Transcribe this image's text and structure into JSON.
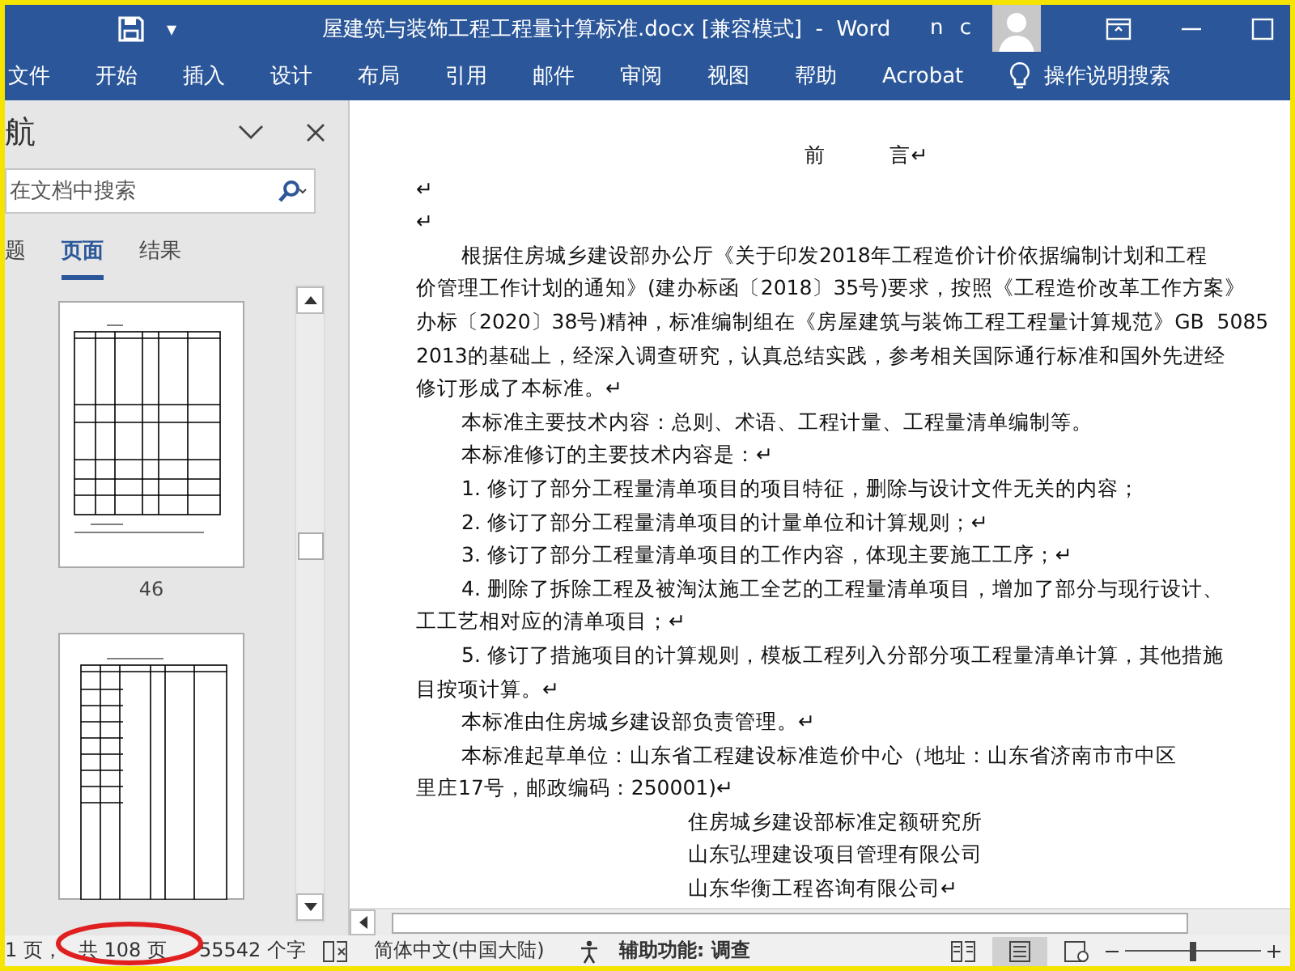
{
  "title_bar": {
    "quick_access_caret": "▾",
    "title": "屋建筑与装饰工程工程量计算标准.docx [兼容模式]  -  Word",
    "user": "n c"
  },
  "ribbon_tabs": [
    "文件",
    "开始",
    "插入",
    "设计",
    "布局",
    "引用",
    "邮件",
    "审阅",
    "视图",
    "帮助",
    "Acrobat"
  ],
  "tell_me": "操作说明搜索",
  "navigation": {
    "title": "航",
    "search": {
      "placeholder": "在文档中搜索"
    },
    "tabs": [
      {
        "label": "题",
        "selected": false
      },
      {
        "label": "页面",
        "selected": true
      },
      {
        "label": "结果",
        "selected": false
      }
    ],
    "pages": [
      {
        "number": "46",
        "kind": "wide"
      },
      {
        "kind": "narrow"
      }
    ]
  },
  "document": {
    "lines": [
      {
        "text": "前          言↵",
        "kind": "heading"
      },
      {
        "text": "↵",
        "kind": "plain"
      },
      {
        "text": "↵",
        "kind": "plain"
      },
      {
        "text": "根据住房城乡建设部办公厅《关于印发2018年工程造价计价依据编制计划和工程",
        "kind": "indent"
      },
      {
        "text": "价管理工作计划的通知》(建办标函〔2018〕35号)要求，按照《工程造价改革工作方案》",
        "kind": "plain"
      },
      {
        "text": "办标〔2020〕38号)精神，标准编制组在《房屋建筑与装饰工程工程量计算规范》GB  5085",
        "kind": "plain"
      },
      {
        "text": "2013的基础上，经深入调查研究，认真总结实践，参考相关国际通行标准和国外先进经",
        "kind": "plain"
      },
      {
        "text": "修订形成了本标准。↵",
        "kind": "plain"
      },
      {
        "text": "本标准主要技术内容：总则、术语、工程计量、工程量清单编制等。",
        "kind": "indent"
      },
      {
        "text": "本标准修订的主要技术内容是：↵",
        "kind": "indent"
      },
      {
        "text": "1. 修订了部分工程量清单项目的项目特征，删除与设计文件无关的内容；",
        "kind": "indent"
      },
      {
        "text": "2. 修订了部分工程量清单项目的计量单位和计算规则；↵",
        "kind": "indent"
      },
      {
        "text": "3. 修订了部分工程量清单项目的工作内容，体现主要施工工序；↵",
        "kind": "indent"
      },
      {
        "text": "4. 删除了拆除工程及被淘汰施工全艺的工程量清单项目，增加了部分与现行设计、",
        "kind": "indent"
      },
      {
        "text": "工工艺相对应的清单项目；↵",
        "kind": "plain"
      },
      {
        "text": "5. 修订了措施项目的计算规则，模板工程列入分部分项工程量清单计算，其他措施",
        "kind": "indent"
      },
      {
        "text": "目按项计算。↵",
        "kind": "plain"
      },
      {
        "text": "本标准由住房城乡建设部负责管理。↵",
        "kind": "indent"
      },
      {
        "text": "本标准起草单位：山东省工程建设标准造价中心（地址：山东省济南市市中区",
        "kind": "indent"
      },
      {
        "text": "里庄17号，邮政编码：250001)↵",
        "kind": "plain"
      },
      {
        "text": "住房城乡建设部标准定额研究所",
        "kind": "center"
      },
      {
        "text": "山东弘理建设项目管理有限公司",
        "kind": "center"
      },
      {
        "text": "山东华衡工程咨询有限公司↵",
        "kind": "center"
      }
    ]
  },
  "status_bar": {
    "page": "1 页，",
    "total_pages": "共 108 页",
    "words": "55542 个字",
    "language": "简体中文(中国大陆)",
    "accessibility": "辅助功能: 调查",
    "zoom": {
      "level": 0.5
    }
  }
}
